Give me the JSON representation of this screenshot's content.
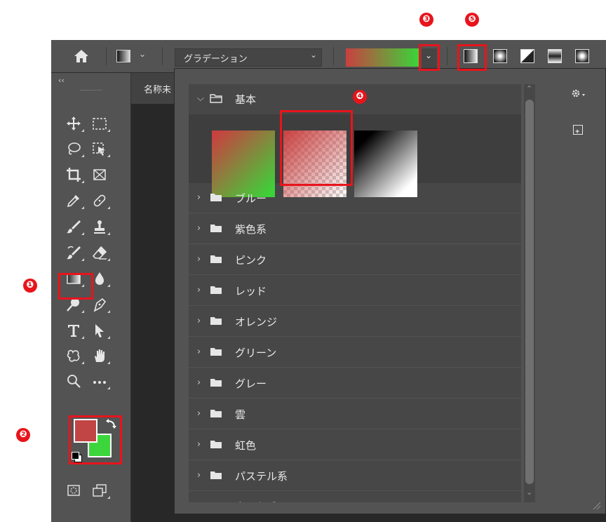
{
  "options_bar": {
    "preset_field": "グラデーション",
    "gradient_preview_colors": [
      "#c94040",
      "#3ad43a"
    ],
    "gradient_types": [
      "linear",
      "radial",
      "angle",
      "reflected",
      "diamond"
    ]
  },
  "document": {
    "tab_label": "名称未"
  },
  "panel": {
    "expanded_folder": {
      "name": "基本"
    },
    "presets": [
      {
        "name": "foreground-to-background",
        "from": "#c94040",
        "to": "#3ad43a"
      },
      {
        "name": "foreground-to-transparent",
        "from": "#c94040",
        "to": "transparent"
      },
      {
        "name": "black-to-white",
        "from": "#000000",
        "to": "#ffffff"
      }
    ],
    "folders": [
      {
        "name": "ブルー"
      },
      {
        "name": "紫色系"
      },
      {
        "name": "ピンク"
      },
      {
        "name": "レッド"
      },
      {
        "name": "オレンジ"
      },
      {
        "name": "グリーン"
      },
      {
        "name": "グレー"
      },
      {
        "name": "雲"
      },
      {
        "name": "虹色"
      },
      {
        "name": "パステル系"
      },
      {
        "name": "中間色系"
      }
    ]
  },
  "colors": {
    "foreground": "#c24545",
    "background": "#3cd63c",
    "highlight": "#e8141c"
  },
  "annotations": [
    "❶",
    "❷",
    "❸",
    "❹",
    "❺"
  ]
}
